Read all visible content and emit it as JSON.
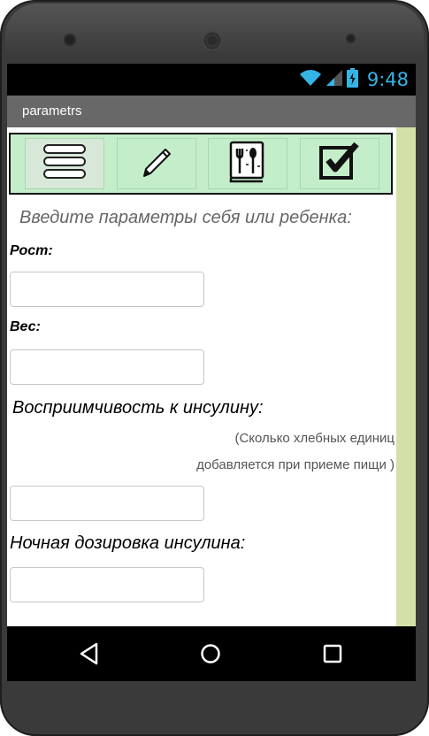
{
  "status_bar": {
    "time": "9:48",
    "icons": [
      "wifi-icon",
      "signal-icon",
      "battery-charging-icon"
    ]
  },
  "title_bar": {
    "title": "parametrs"
  },
  "toolbar": {
    "buttons": [
      "menu-icon",
      "pencil-icon",
      "recipe-book-icon",
      "checkbox-icon"
    ]
  },
  "form": {
    "intro": "Введите параметры себя или ребенка:",
    "height_label": "Рост:",
    "height_value": "",
    "weight_label": "Вес:",
    "weight_value": "",
    "sensitivity_label": "Восприимчивость к инсулину:",
    "sensitivity_hint_1": "(Сколько хлебных единиц",
    "sensitivity_hint_2": "добавляется при приеме пищи )",
    "sensitivity_value": "",
    "night_dose_label": "Ночная дозировка инсулина:",
    "night_dose_value": ""
  },
  "nav_bar": {
    "buttons": [
      "back-icon",
      "home-icon",
      "recents-icon"
    ]
  },
  "colors": {
    "accent": "#33b5e5",
    "toolbar_bg": "#c3eec9",
    "side_strip": "#d3e1a7",
    "title_bar": "#686868"
  }
}
